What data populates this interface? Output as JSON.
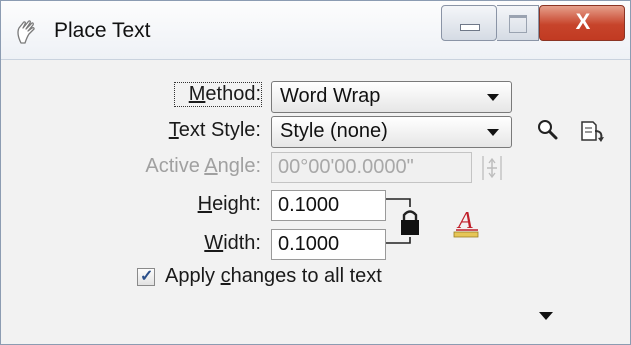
{
  "window": {
    "title": "Place Text",
    "close_symbol": "X"
  },
  "icons": {
    "title": "hand-place-text-icon",
    "search": "magnifier-icon",
    "style_manager": "text-style-manager-icon",
    "angle_spinner": "spinner-icon",
    "lock": "padlock-icon",
    "text_attributes": "text-attributes-icon",
    "more": "chevron-down-icon"
  },
  "form": {
    "method": {
      "label": "Method:",
      "value": "Word Wrap"
    },
    "text_style": {
      "label": "Text Style:",
      "value": "Style (none)"
    },
    "active_angle": {
      "label": "Active Angle:",
      "value": "00°00'00.0000\""
    },
    "height": {
      "label": "Height:",
      "value": "0.1000"
    },
    "width": {
      "label": "Width:",
      "value": "0.1000"
    },
    "apply_changes": {
      "label": "Apply changes to all text",
      "checked": true
    }
  },
  "colors": {
    "close_button": "#c7442b",
    "text_attr_red": "#c0202a",
    "text_attr_gold": "#c9a227"
  }
}
